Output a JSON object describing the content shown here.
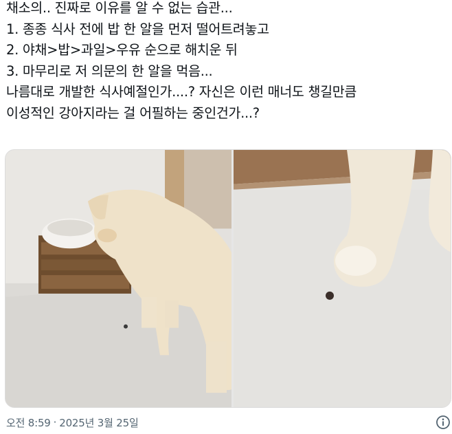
{
  "post": {
    "lines": [
      "채소의.. 진짜로 이유를 알 수 없는 습관...",
      "1. 종종 식사 전에 밥 한 알을 먼저 떨어트려놓고",
      "2. 야채>밥>과일>우유 순으로 해치운 뒤",
      "3. 마무리로 저 의문의 한 알을 먹음...",
      "나름대로 개발한 식사예절인가....? 자신은 이런 매너도 챙길만큼",
      "이성적인 강아지라는 걸 어필하는 중인건가...?"
    ]
  },
  "media": {
    "photos": [
      {
        "subject": "white dog eating from bowl on wooden crate, kibble on floor"
      },
      {
        "subject": "close-up of dog's front paws next to a single kibble"
      }
    ]
  },
  "meta": {
    "time": "오전 8:59",
    "separator": "·",
    "date": "2025년 3월 25일"
  },
  "icons": {
    "info": "info-icon"
  }
}
